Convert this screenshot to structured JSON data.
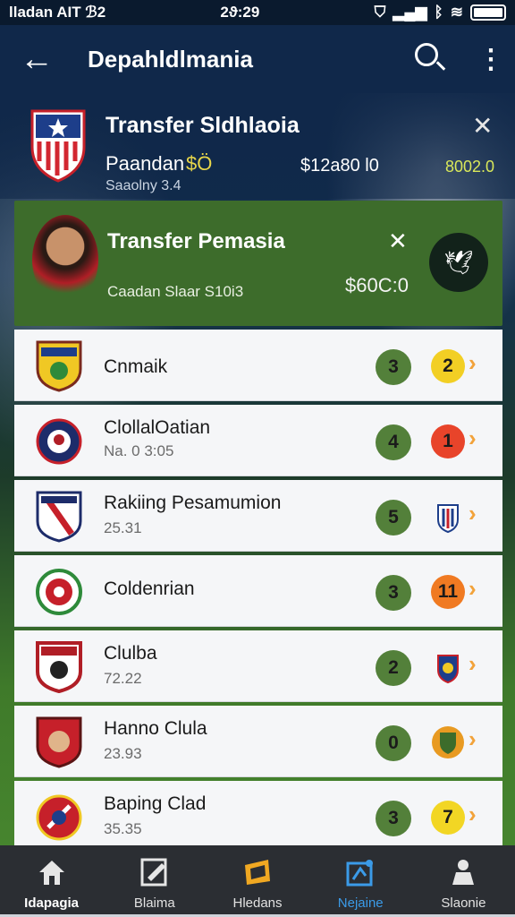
{
  "status_bar": {
    "carrier": "lladan AIT  ℬ2",
    "time": "2ϑ:29"
  },
  "app_bar": {
    "title": "Depahldlmania"
  },
  "transfer_card": {
    "title": "Transfer Sldhlaoia",
    "name": "Paandan",
    "fee": "$Ö",
    "amount": "$12a80 l0",
    "amount2": "8002.0",
    "sub": "Saaolny 3.4"
  },
  "promo_card": {
    "title": "Transfer Pemasia",
    "sub": "Caadan Slaar S10i3",
    "amount": "$60C:0"
  },
  "clubs": [
    {
      "name": "Cnmaik",
      "sub": "",
      "score": "3",
      "badge": "2",
      "badge_color": "#f2cf24"
    },
    {
      "name": "ClollalOatian",
      "sub": "Na. 0 3:05",
      "score": "4",
      "badge": "1",
      "badge_color": "#e8442a"
    },
    {
      "name": "Rakiing Pesamumion",
      "sub": "25.31",
      "score": "5",
      "badge": "",
      "badge_color": ""
    },
    {
      "name": "Coldenrian",
      "sub": "",
      "score": "3",
      "badge": "11",
      "badge_color": "#f07a22"
    },
    {
      "name": "Clulba",
      "sub": "72.22",
      "score": "2",
      "badge": "",
      "badge_color": ""
    },
    {
      "name": "Hanno Clula",
      "sub": "23.93",
      "score": "0",
      "badge": "",
      "badge_color": "#e89a22"
    },
    {
      "name": "Baping Clad",
      "sub": "35.35",
      "score": "3",
      "badge": "7",
      "badge_color": "#f2d624"
    }
  ],
  "bottom_nav": [
    {
      "label": "Idapagia",
      "icon": "home-icon"
    },
    {
      "label": "Blaima",
      "icon": "edit-icon"
    },
    {
      "label": "Hledans",
      "icon": "ticket-icon"
    },
    {
      "label": "Nejaine",
      "icon": "scan-icon"
    },
    {
      "label": "Slaonie",
      "icon": "player-icon"
    }
  ]
}
